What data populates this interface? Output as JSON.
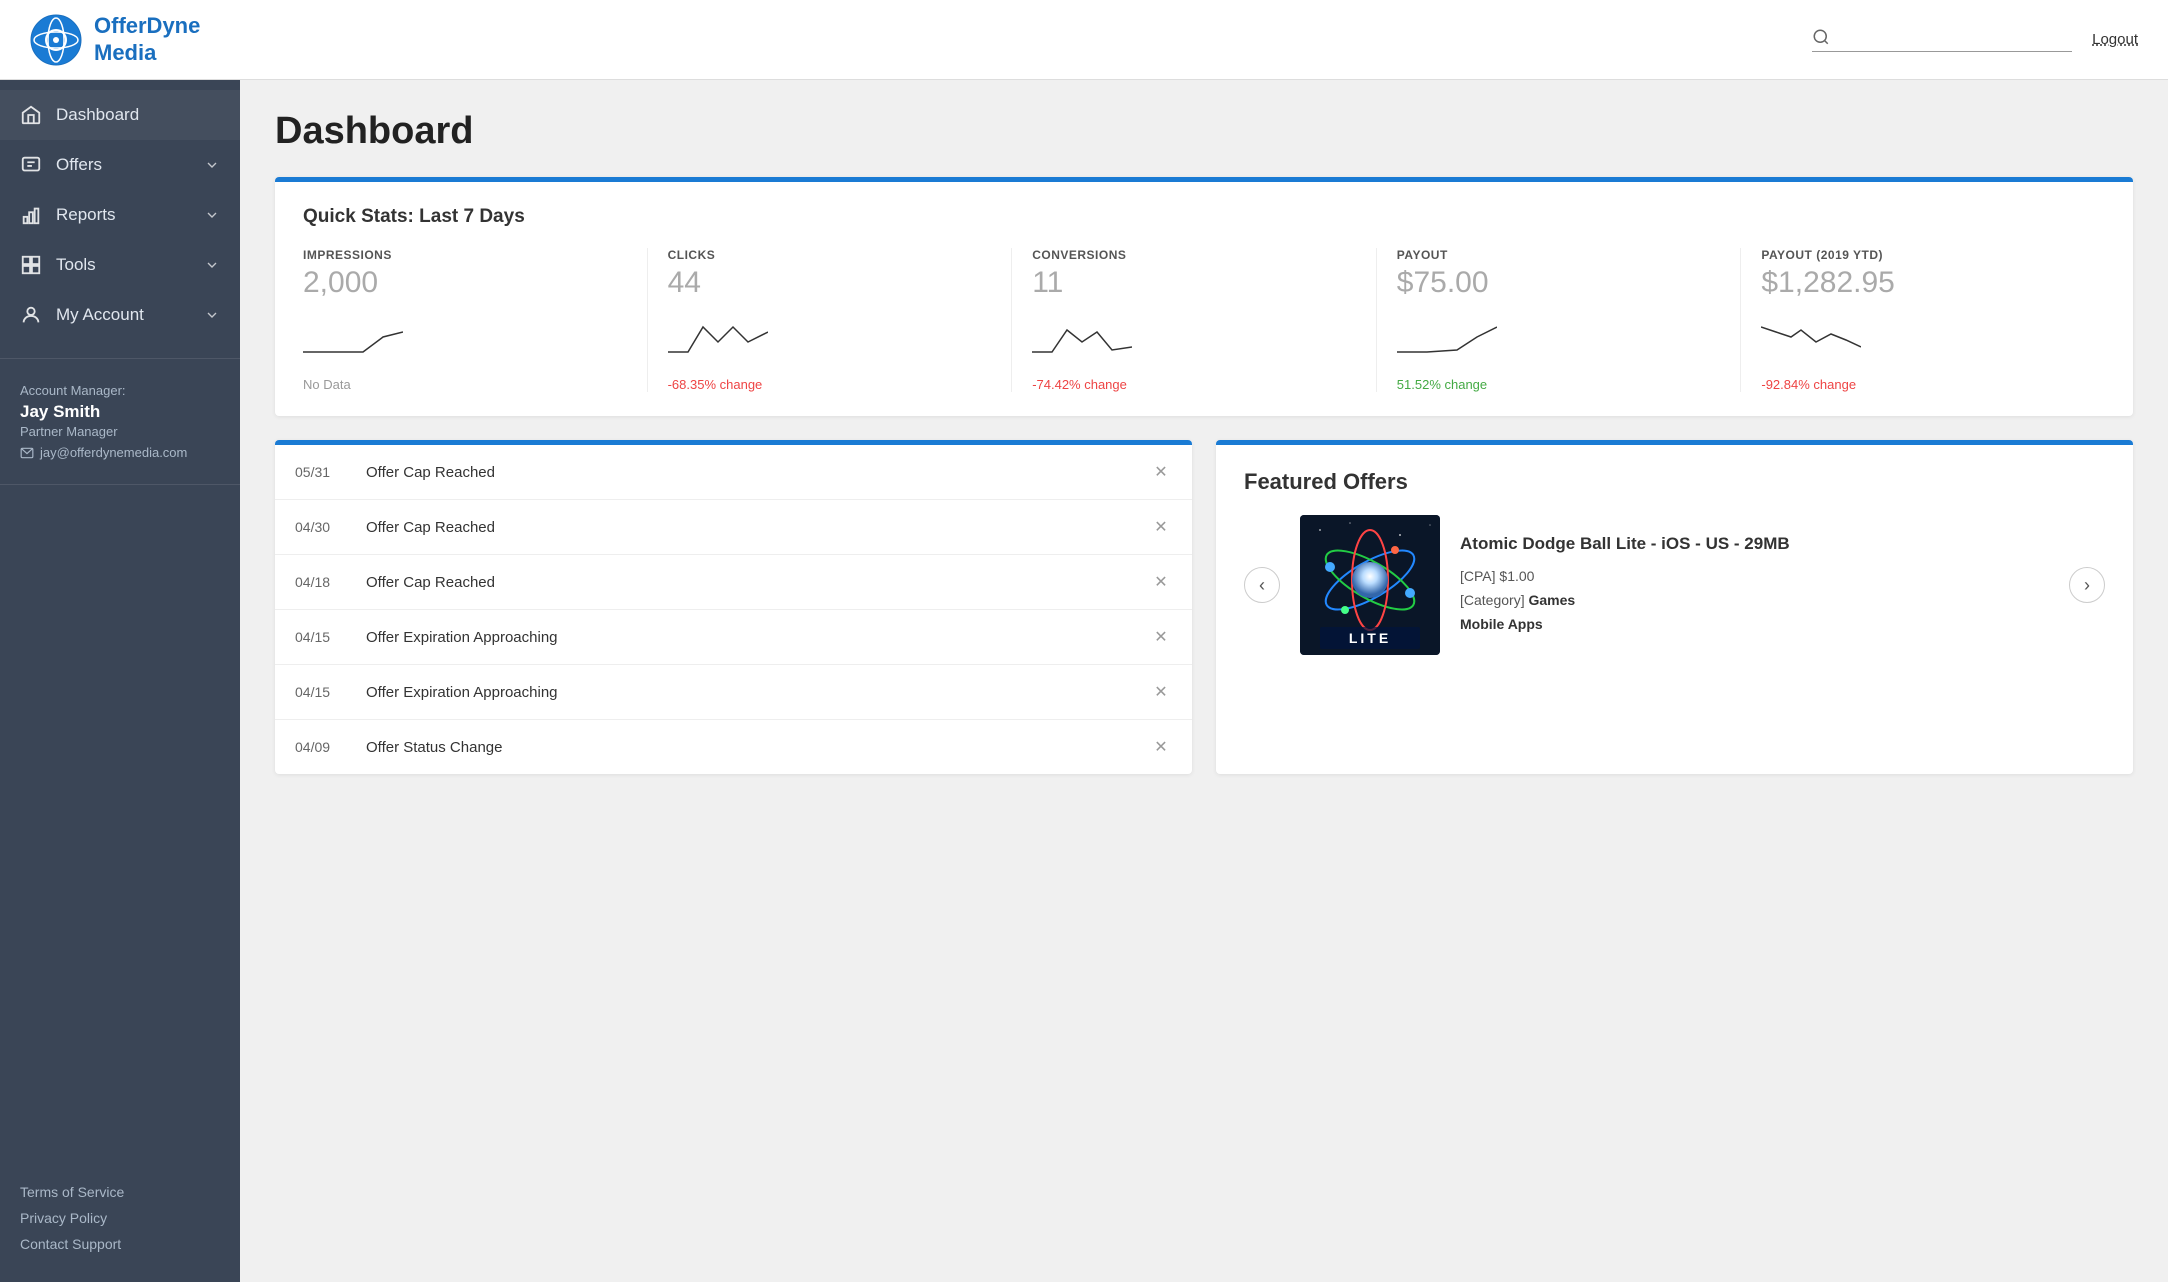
{
  "header": {
    "logo_line1": "OfferDyne",
    "logo_line2": "Media",
    "search_placeholder": "",
    "logout_label": "Logout"
  },
  "sidebar": {
    "nav_items": [
      {
        "id": "dashboard",
        "label": "Dashboard",
        "icon": "home",
        "has_chevron": false
      },
      {
        "id": "offers",
        "label": "Offers",
        "icon": "chat",
        "has_chevron": true
      },
      {
        "id": "reports",
        "label": "Reports",
        "icon": "bar-chart",
        "has_chevron": true
      },
      {
        "id": "tools",
        "label": "Tools",
        "icon": "grid",
        "has_chevron": true
      },
      {
        "id": "my-account",
        "label": "My Account",
        "icon": "person",
        "has_chevron": true
      }
    ],
    "account_manager": {
      "label": "Account Manager:",
      "name": "Jay Smith",
      "role": "Partner Manager",
      "email": "jay@offerdynemedia.com"
    },
    "footer_links": [
      {
        "id": "terms",
        "label": "Terms of Service"
      },
      {
        "id": "privacy",
        "label": "Privacy Policy"
      },
      {
        "id": "support",
        "label": "Contact Support"
      }
    ]
  },
  "main": {
    "page_title": "Dashboard",
    "quick_stats": {
      "title": "Quick Stats: Last 7 Days",
      "stats": [
        {
          "id": "impressions",
          "label": "IMPRESSIONS",
          "value": "2,000",
          "change": "No Data",
          "change_type": "nodata"
        },
        {
          "id": "clicks",
          "label": "CLICKS",
          "value": "44",
          "change": "-68.35% change",
          "change_type": "red"
        },
        {
          "id": "conversions",
          "label": "CONVERSIONS",
          "value": "11",
          "change": "-74.42% change",
          "change_type": "red"
        },
        {
          "id": "payout",
          "label": "PAYOUT",
          "value": "$75.00",
          "change": "51.52% change",
          "change_type": "green"
        },
        {
          "id": "payout-ytd",
          "label": "PAYOUT (2019 YTD)",
          "value": "$1,282.95",
          "change": "-92.84% change",
          "change_type": "red"
        }
      ]
    },
    "notifications": {
      "items": [
        {
          "date": "05/31",
          "text": "Offer Cap Reached"
        },
        {
          "date": "04/30",
          "text": "Offer Cap Reached"
        },
        {
          "date": "04/18",
          "text": "Offer Cap Reached"
        },
        {
          "date": "04/15",
          "text": "Offer Expiration Approaching"
        },
        {
          "date": "04/15",
          "text": "Offer Expiration Approaching"
        },
        {
          "date": "04/09",
          "text": "Offer Status Change"
        }
      ]
    },
    "featured_offers": {
      "title": "Featured Offers",
      "offer": {
        "name": "Atomic Dodge Ball Lite - iOS - US - 29MB",
        "cpa": "$1.00",
        "category": "Games",
        "subcategory": "Mobile Apps"
      }
    }
  }
}
